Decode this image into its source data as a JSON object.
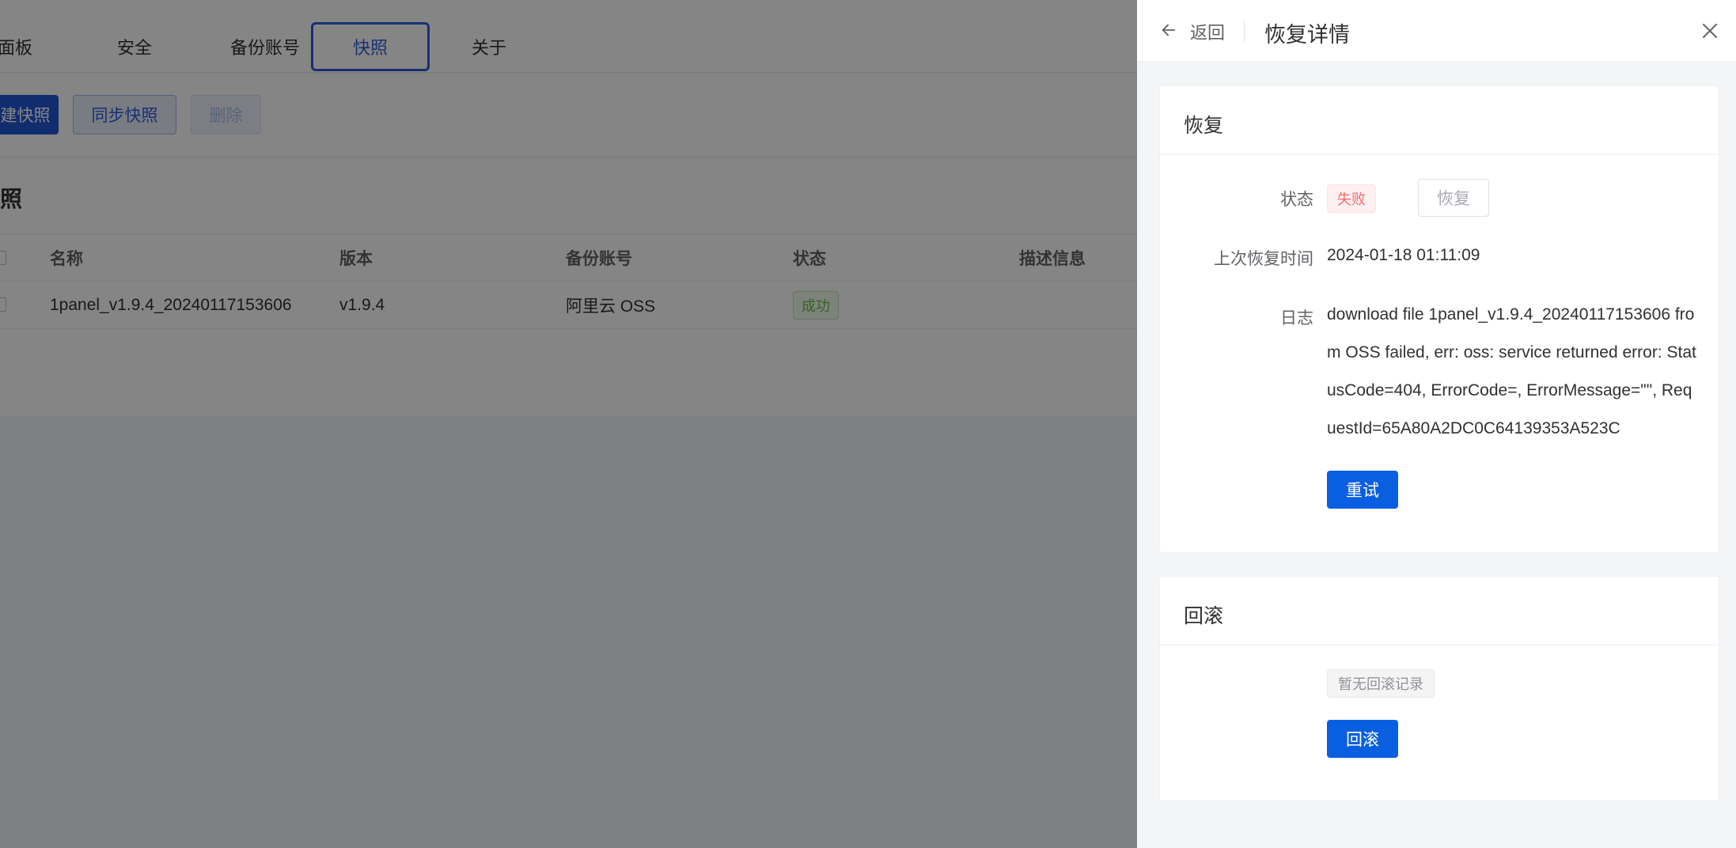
{
  "background": {
    "tabs": [
      "面板",
      "安全",
      "备份账号",
      "快照",
      "关于"
    ],
    "active_tab": "快照",
    "toolbar": {
      "create_label": "建快照",
      "sync_label": "同步快照",
      "delete_label": "删除"
    },
    "section_title": "照",
    "table": {
      "headers": [
        "名称",
        "版本",
        "备份账号",
        "状态",
        "描述信息"
      ],
      "rows": [
        {
          "name": "1panel_v1.9.4_20240117153606",
          "version": "v1.9.4",
          "account": "阿里云 OSS",
          "status": "成功"
        }
      ]
    }
  },
  "drawer": {
    "back_label": "返回",
    "title": "恢复详情",
    "restore": {
      "title": "恢复",
      "status_label": "状态",
      "status_tag": "失败",
      "restore_button": "恢复",
      "last_time_label": "上次恢复时间",
      "last_time_value": "2024-01-18 01:11:09",
      "log_label": "日志",
      "log_lines": [
        "download file 1panel_v1.9.4_20240117153606 fro",
        "m OSS failed, err: oss: service returned error: Stat",
        "usCode=404, ErrorCode=, ErrorMessage=\"\", Req",
        "uestId=65A80A2DC0C64139353A523C"
      ],
      "retry_button": "重试"
    },
    "rollback": {
      "title": "回滚",
      "empty_tag": "暂无回滚记录",
      "rollback_button": "回滚"
    }
  },
  "colors": {
    "primary": "#0a5fe0",
    "danger": "#f56c6c",
    "success": "#67c23a"
  }
}
